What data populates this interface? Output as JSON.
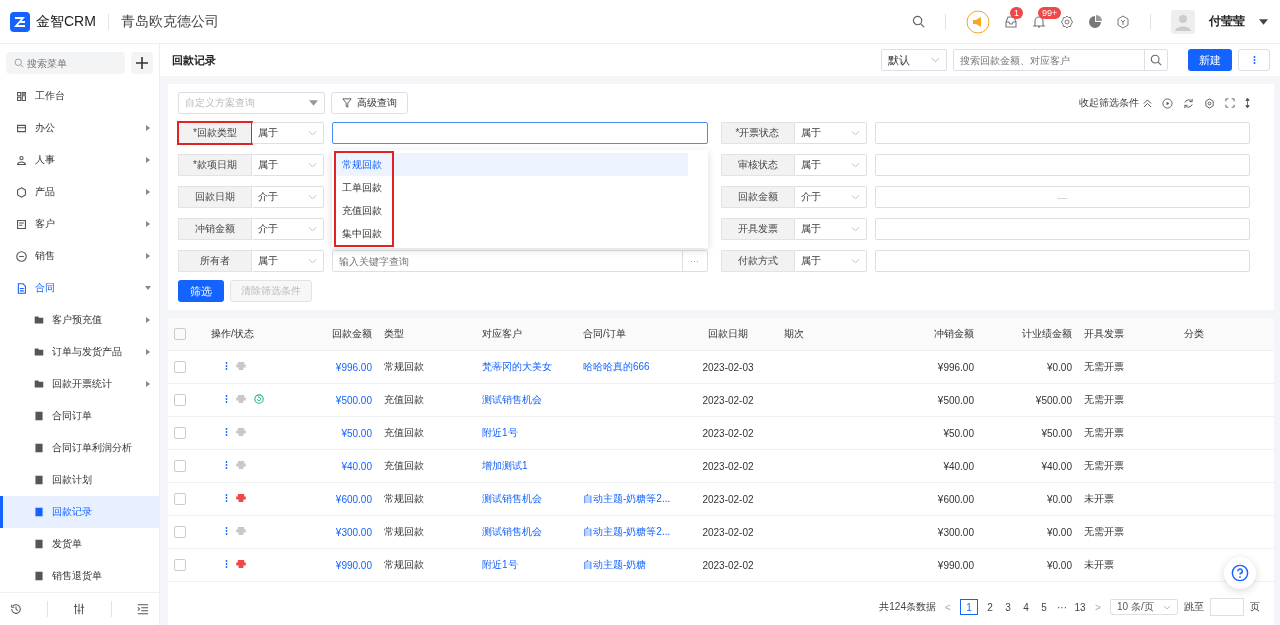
{
  "header": {
    "logo": "金智CRM",
    "company": "青岛欧克德公司",
    "badges": [
      {
        "kind": "inbox",
        "count": "1"
      },
      {
        "kind": "bell",
        "count": "99+"
      }
    ],
    "user": "付莹莹"
  },
  "sidebar": {
    "search": {
      "placeholder": "搜索菜单"
    },
    "items": [
      {
        "label": "工作台",
        "expandable": false,
        "expanded": false,
        "selected": false
      },
      {
        "label": "办公",
        "expandable": true,
        "expanded": false,
        "selected": false
      },
      {
        "label": "人事",
        "expandable": true,
        "expanded": false,
        "selected": false
      },
      {
        "label": "产品",
        "expandable": true,
        "expanded": false,
        "selected": false
      },
      {
        "label": "客户",
        "expandable": true,
        "expanded": false,
        "selected": false
      },
      {
        "label": "销售",
        "expandable": true,
        "expanded": false,
        "selected": false
      },
      {
        "label": "合同",
        "expandable": true,
        "expanded": true,
        "selected": false,
        "children": [
          {
            "label": "客户预充值",
            "expandable": true,
            "selected": false
          },
          {
            "label": "订单与发货产品",
            "expandable": true,
            "selected": false
          },
          {
            "label": "回款开票统计",
            "expandable": true,
            "selected": false
          },
          {
            "label": "合同订单",
            "expandable": false,
            "selected": false
          },
          {
            "label": "合同订单利润分析",
            "expandable": false,
            "selected": false
          },
          {
            "label": "回款计划",
            "expandable": false,
            "selected": false
          },
          {
            "label": "回款记录",
            "expandable": false,
            "selected": true
          },
          {
            "label": "发货单",
            "expandable": false,
            "selected": false
          },
          {
            "label": "销售退货单",
            "expandable": false,
            "selected": false
          }
        ]
      }
    ]
  },
  "page": {
    "title": "回款记录",
    "view": "默认",
    "search": {
      "placeholder": "搜索回款金额、对应客户"
    },
    "new_button": "新建"
  },
  "filter": {
    "scheme": {
      "placeholder": "自定义方案查询"
    },
    "advanced": "高级查询",
    "collapse": "收起筛选条件",
    "left": [
      {
        "label": "*回款类型",
        "operator": "属于",
        "highlighted": true,
        "value": {
          "kind": "focused"
        }
      },
      {
        "label": "*款项日期",
        "operator": "属于",
        "highlighted": false
      },
      {
        "label": "回款日期",
        "operator": "介于",
        "highlighted": false
      },
      {
        "label": "冲销金额",
        "operator": "介于",
        "highlighted": false
      },
      {
        "label": "所有者",
        "operator": "属于",
        "highlighted": false,
        "value": {
          "kind": "lookup",
          "placeholder": "输入关键字查询",
          "button": "···"
        }
      }
    ],
    "right": [
      {
        "label": "*开票状态",
        "operator": "属于",
        "value": {
          "kind": "text"
        }
      },
      {
        "label": "审核状态",
        "operator": "属于",
        "value": {
          "kind": "text"
        }
      },
      {
        "label": "回款金额",
        "operator": "介于",
        "value": {
          "kind": "range",
          "separator": "—"
        }
      },
      {
        "label": "开具发票",
        "operator": "属于",
        "value": {
          "kind": "text"
        }
      },
      {
        "label": "付款方式",
        "operator": "属于",
        "value": {
          "kind": "text"
        }
      }
    ],
    "dropdown": {
      "outlined": true,
      "options": [
        {
          "label": "常规回款",
          "selected": true
        },
        {
          "label": "工单回款",
          "selected": false
        },
        {
          "label": "充值回款",
          "selected": false
        },
        {
          "label": "集中回款",
          "selected": false
        }
      ]
    },
    "apply": "筛选",
    "clear": "清除筛选条件"
  },
  "table": {
    "select_all": false,
    "columns": [
      "操作/状态",
      "回款金额",
      "类型",
      "对应客户",
      "合同/订单",
      "回款日期",
      "期次",
      "冲销金额",
      "计业绩金额",
      "开具发票",
      "分类"
    ],
    "rows": [
      {
        "checked": false,
        "flagged": false,
        "synced": false,
        "amount": "¥996.00",
        "type": "常规回款",
        "customer": "梵蒂冈的大美女",
        "contract": "哈哈哈真的666",
        "date": "2023-02-03",
        "writeoff": "¥996.00",
        "performance": "¥0.00",
        "invoice": "无需开票"
      },
      {
        "checked": false,
        "flagged": false,
        "synced": true,
        "amount": "¥500.00",
        "type": "充值回款",
        "customer": "测试销售机会",
        "date": "2023-02-02",
        "writeoff": "¥500.00",
        "performance": "¥500.00",
        "invoice": "无需开票"
      },
      {
        "checked": false,
        "flagged": false,
        "synced": false,
        "amount": "¥50.00",
        "type": "充值回款",
        "customer": "附近1号",
        "date": "2023-02-02",
        "writeoff": "¥50.00",
        "performance": "¥50.00",
        "invoice": "无需开票"
      },
      {
        "checked": false,
        "flagged": false,
        "synced": false,
        "amount": "¥40.00",
        "type": "充值回款",
        "customer": "增加测试1",
        "date": "2023-02-02",
        "writeoff": "¥40.00",
        "performance": "¥40.00",
        "invoice": "无需开票"
      },
      {
        "checked": false,
        "flagged": true,
        "synced": false,
        "amount": "¥600.00",
        "type": "常规回款",
        "customer": "测试销售机会",
        "contract": "自动主题-奶糖等2...",
        "date": "2023-02-02",
        "writeoff": "¥600.00",
        "performance": "¥0.00",
        "invoice": "未开票"
      },
      {
        "checked": false,
        "flagged": false,
        "synced": false,
        "amount": "¥300.00",
        "type": "常规回款",
        "customer": "测试销售机会",
        "contract": "自动主题-奶糖等2...",
        "date": "2023-02-02",
        "writeoff": "¥300.00",
        "performance": "¥0.00",
        "invoice": "无需开票"
      },
      {
        "checked": false,
        "flagged": true,
        "synced": false,
        "amount": "¥990.00",
        "type": "常规回款",
        "customer": "附近1号",
        "contract": "自动主题-奶糖",
        "date": "2023-02-02",
        "writeoff": "¥990.00",
        "performance": "¥0.00",
        "invoice": "未开票"
      }
    ]
  },
  "pagination": {
    "total": "共124条数据",
    "pages": [
      {
        "label": "1",
        "selected": true
      },
      {
        "label": "2",
        "selected": false
      },
      {
        "label": "3",
        "selected": false
      },
      {
        "label": "4",
        "selected": false
      },
      {
        "label": "5",
        "selected": false
      },
      {
        "label": "···",
        "selected": false
      },
      {
        "label": "13",
        "selected": false
      }
    ],
    "prev": "<",
    "next": ">",
    "page_size": "10 条/页",
    "jump": "跳至",
    "unit": "页"
  }
}
